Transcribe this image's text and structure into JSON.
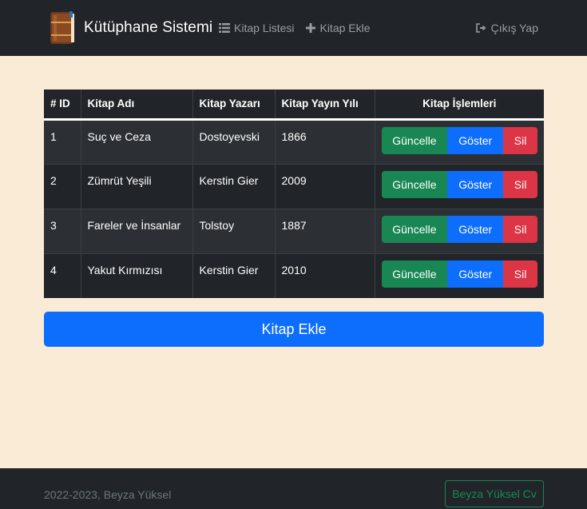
{
  "navbar": {
    "brand_title": "Kütüphane Sistemi",
    "links": [
      {
        "label": "Kitap Listesi",
        "icon": "list-icon"
      },
      {
        "label": "Kitap Ekle",
        "icon": "plus-icon"
      }
    ],
    "logout_label": "Çıkış Yap",
    "logout_icon": "sign-out-icon"
  },
  "table": {
    "headers": [
      "# ID",
      "Kitap Adı",
      "Kitap Yazarı",
      "Kitap Yayın Yılı",
      "Kitap İşlemleri"
    ],
    "rows": [
      {
        "id": "1",
        "title": "Suç ve Ceza",
        "author": "Dostoyevski",
        "year": "1866"
      },
      {
        "id": "2",
        "title": "Zümrüt Yeşili",
        "author": "Kerstin Gier",
        "year": "2009"
      },
      {
        "id": "3",
        "title": "Fareler ve İnsanlar",
        "author": "Tolstoy",
        "year": "1887"
      },
      {
        "id": "4",
        "title": "Yakut Kırmızısı",
        "author": "Kerstin Gier",
        "year": "2010"
      }
    ],
    "actions": {
      "update_label": "Güncelle",
      "show_label": "Göster",
      "delete_label": "Sil"
    }
  },
  "add_button_label": "Kitap Ekle",
  "footer": {
    "text": "2022-2023, Beyza Yüksel",
    "cv_button_label": "Beyza Yüksel Cv"
  },
  "colors": {
    "background": "#faebd7",
    "navbar": "#212529",
    "primary": "#0d6efd",
    "success": "#198754",
    "danger": "#dc3545"
  }
}
